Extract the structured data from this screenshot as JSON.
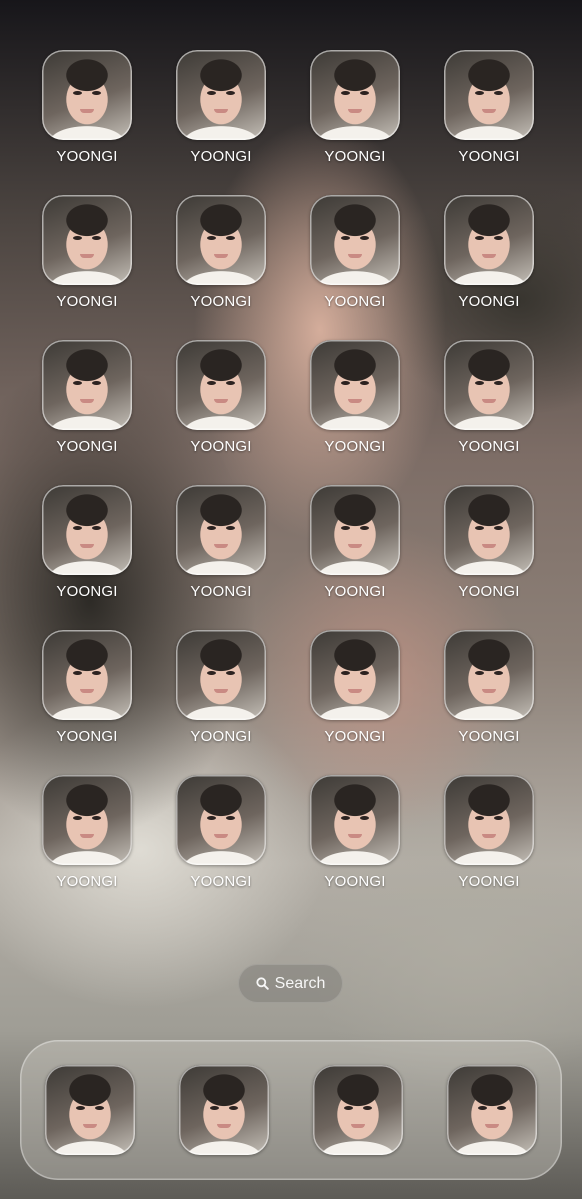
{
  "home_screen": {
    "apps": [
      {
        "label": "YOONGI",
        "icon": "yoongi-photo-icon"
      },
      {
        "label": "YOONGI",
        "icon": "yoongi-photo-icon"
      },
      {
        "label": "YOONGI",
        "icon": "yoongi-photo-icon"
      },
      {
        "label": "YOONGI",
        "icon": "yoongi-photo-icon"
      },
      {
        "label": "YOONGI",
        "icon": "yoongi-photo-icon"
      },
      {
        "label": "YOONGI",
        "icon": "yoongi-photo-icon"
      },
      {
        "label": "YOONGI",
        "icon": "yoongi-photo-icon"
      },
      {
        "label": "YOONGI",
        "icon": "yoongi-photo-icon"
      },
      {
        "label": "YOONGI",
        "icon": "yoongi-photo-icon"
      },
      {
        "label": "YOONGI",
        "icon": "yoongi-photo-icon"
      },
      {
        "label": "YOONGI",
        "icon": "yoongi-photo-icon"
      },
      {
        "label": "YOONGI",
        "icon": "yoongi-photo-icon"
      },
      {
        "label": "YOONGI",
        "icon": "yoongi-photo-icon"
      },
      {
        "label": "YOONGI",
        "icon": "yoongi-photo-icon"
      },
      {
        "label": "YOONGI",
        "icon": "yoongi-photo-icon"
      },
      {
        "label": "YOONGI",
        "icon": "yoongi-photo-icon"
      },
      {
        "label": "YOONGI",
        "icon": "yoongi-photo-icon"
      },
      {
        "label": "YOONGI",
        "icon": "yoongi-photo-icon"
      },
      {
        "label": "YOONGI",
        "icon": "yoongi-photo-icon"
      },
      {
        "label": "YOONGI",
        "icon": "yoongi-photo-icon"
      },
      {
        "label": "YOONGI",
        "icon": "yoongi-photo-icon"
      },
      {
        "label": "YOONGI",
        "icon": "yoongi-photo-icon"
      },
      {
        "label": "YOONGI",
        "icon": "yoongi-photo-icon"
      },
      {
        "label": "YOONGI",
        "icon": "yoongi-photo-icon"
      }
    ]
  },
  "search": {
    "label": "Search",
    "icon": "magnifier-icon"
  },
  "dock": {
    "apps": [
      {
        "icon": "yoongi-photo-icon"
      },
      {
        "icon": "yoongi-photo-icon"
      },
      {
        "icon": "yoongi-photo-icon"
      },
      {
        "icon": "yoongi-photo-icon"
      }
    ]
  },
  "colors": {
    "label_text": "#ffffff",
    "dock_glass": "#d2d0c8"
  }
}
